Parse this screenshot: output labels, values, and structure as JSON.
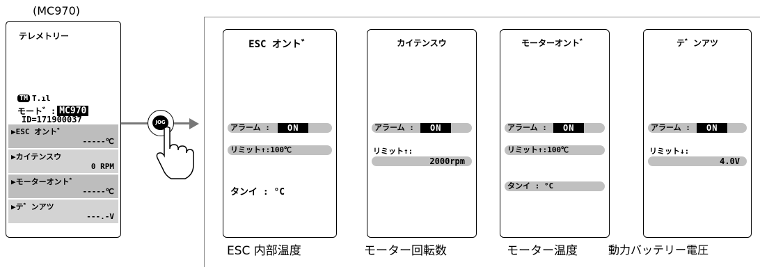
{
  "top_caption": "(MC970)",
  "device": {
    "title": "テレメトリー",
    "tm_badge": "TM",
    "signal": "T.ıl",
    "model_label": "モート゛:",
    "model_value": "MC970",
    "id_text": "ID=171900037",
    "items": [
      {
        "label": "▶ESC オント゛",
        "value": "-----℃"
      },
      {
        "label": "▶カイテンスウ",
        "value": "0 RPM"
      },
      {
        "label": "▶モーターオント゛",
        "value": "-----℃"
      },
      {
        "label": "▶テ゛ンアツ",
        "value": "---.-V"
      }
    ]
  },
  "jog_label": "JOG",
  "screens": [
    {
      "title": "ESC オント゛",
      "alarm_label": "アラーム :",
      "alarm_value": "ON",
      "limit_text": "リミット↑:100℃",
      "unit_text": "タンイ :   °C",
      "caption": "ESC 内部温度"
    },
    {
      "title": "カイテンスウ",
      "alarm_label": "アラーム :",
      "alarm_value": "ON",
      "limit_label": "リミット↑:",
      "limit_value": "2000rpm",
      "caption": "モーター回転数"
    },
    {
      "title": "モーターオント゛",
      "alarm_label": "アラーム :",
      "alarm_value": "ON",
      "limit_text": "リミット↑:100℃",
      "unit_text": "タンイ :   °C",
      "caption": "モーター温度"
    },
    {
      "title": "テ゛ンアツ",
      "alarm_label": "アラーム :",
      "alarm_value": "ON",
      "limit_label": "リミット↓:",
      "limit_value": "4.0V",
      "caption": "動力バッテリー電圧"
    }
  ]
}
